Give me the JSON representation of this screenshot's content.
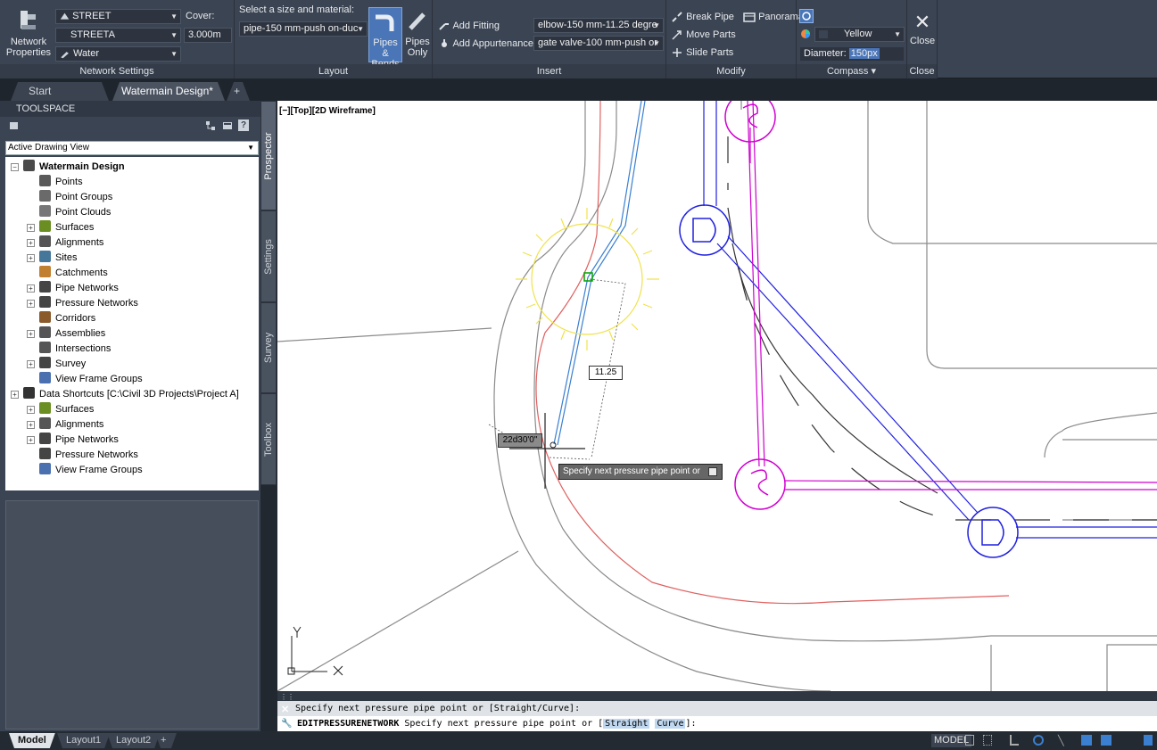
{
  "ribbon": {
    "network_settings": {
      "network_properties_label": "Network Properties",
      "surface_combo": "STREET",
      "alignment_combo": "STREETA",
      "part_list_combo": "Water",
      "cover_label": "Cover:",
      "cover_value": "3.000m",
      "panel_title": "Network Settings"
    },
    "layout": {
      "select_label": "Select a size and material:",
      "size_combo": "pipe-150 mm-push on-duc",
      "pipes_bends_label": "Pipes & Bends",
      "pipes_only_label": "Pipes Only",
      "panel_title": "Layout"
    },
    "insert": {
      "add_fitting": "Add Fitting",
      "add_appurtenance": "Add Appurtenance",
      "fitting_combo": "elbow-150 mm-11.25 degre",
      "appurtenance_combo": "gate valve-100 mm-push or",
      "panel_title": "Insert"
    },
    "modify": {
      "break_pipe": "Break Pipe",
      "panorama": "Panorama",
      "move_parts": "Move Parts",
      "slide_parts": "Slide Parts",
      "panel_title": "Modify"
    },
    "compass": {
      "color_combo": "Yellow",
      "diameter_label": "Diameter:",
      "diameter_value": "150px",
      "panel_title": "Compass ▾"
    },
    "close": {
      "close_label": "Close",
      "panel_title": "Close"
    }
  },
  "file_tabs": [
    "Start",
    "Watermain Design*"
  ],
  "toolspace": {
    "title": "TOOLSPACE",
    "view_combo": "Active Drawing View",
    "vertical_tabs": [
      "Prospector",
      "Settings",
      "Survey",
      "Toolbox"
    ],
    "tree": [
      {
        "label": "Watermain Design",
        "bold": true
      },
      {
        "label": "Points"
      },
      {
        "label": "Point Groups"
      },
      {
        "label": "Point Clouds"
      },
      {
        "label": "Surfaces"
      },
      {
        "label": "Alignments"
      },
      {
        "label": "Sites"
      },
      {
        "label": "Catchments"
      },
      {
        "label": "Pipe Networks"
      },
      {
        "label": "Pressure Networks"
      },
      {
        "label": "Corridors"
      },
      {
        "label": "Assemblies"
      },
      {
        "label": "Intersections"
      },
      {
        "label": "Survey"
      },
      {
        "label": "View Frame Groups"
      },
      {
        "label": "Data Shortcuts [C:\\Civil 3D Projects\\Project A]"
      },
      {
        "label": "Surfaces"
      },
      {
        "label": "Alignments"
      },
      {
        "label": "Pipe Networks"
      },
      {
        "label": "Pressure Networks"
      },
      {
        "label": "View Frame Groups"
      }
    ]
  },
  "viewport": {
    "label": "[−][Top][2D Wireframe]",
    "angle_label": "11.25",
    "input_angle": "22d30'0\"",
    "tooltip": "Specify next pressure pipe point or",
    "ucs_x": "X",
    "ucs_y": "Y"
  },
  "command": {
    "history": "Specify next pressure pipe point or [Straight/Curve]:",
    "prompt_cmd": "EDITPRESSURENETWORK",
    "prompt_text": " Specify next pressure pipe point or [",
    "kw1": "Straight",
    "kw2": "Curve",
    "prompt_end": "]:"
  },
  "status": {
    "layout_tabs": [
      "Model",
      "Layout1",
      "Layout2"
    ],
    "mode": "MODEL"
  },
  "colors": {
    "ribbon": "#3b4453",
    "active_button": "#4a76b8",
    "pipe_blue": "#3a7fd0",
    "magenta": "#d000d0",
    "compass_yellow": "#f0e24a",
    "red_line": "#e06060"
  }
}
